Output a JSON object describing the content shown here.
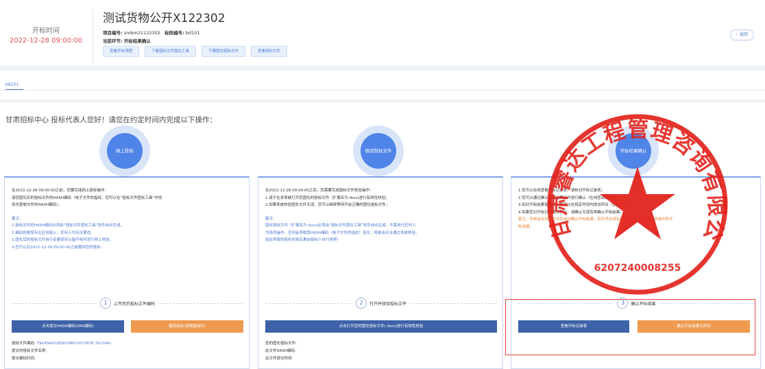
{
  "header": {
    "time_label": "开标时间",
    "time_value": "2022-12-28 09:00:00",
    "title": "测试货物公开X122302",
    "project_no_label": "项目编号:",
    "project_no": "smbm22122302",
    "section_no_label": "标段编号:",
    "section_no": "bd101",
    "stage_label": "当前环节:",
    "stage_value": "开标结果确认",
    "buttons": [
      "查看开标流程",
      "下载招标文件固化工具",
      "下载固化招标文件",
      "查看招标文件"
    ],
    "back_label": "返回"
  },
  "tabs": {
    "active": "bd101"
  },
  "greeting": "甘肃招标中心 投标代表人您好！请您在约定时间内完成以下操作：",
  "steps": [
    {
      "circle_label": "网上投标",
      "lines": [
        {
          "t": "在2022-12-28 09:00:00之前，您要完成网上投标操作：",
          "c": ""
        },
        {
          "t": "请您固化后的投标文件的HASH编码（电子文件的指纹，您可以在“投标文件固化工具”中找",
          "c": ""
        },
        {
          "t": "到并复制文件的HASH编码）。",
          "c": ""
        },
        {
          "t": "备注：",
          "c": "blue"
        },
        {
          "t": "1.投标文件的HASH编码必须由“投标文件固化工具”软件自动生成。",
          "c": "blue"
        },
        {
          "t": "2.编码将被保存在区块链上，任何人均无法更改。",
          "c": "blue"
        },
        {
          "t": "3.固化后的投标文件自行妥善保存以备开标时进行网上核验。",
          "c": "blue"
        },
        {
          "t": "4.您可以在2022-12-28 09:00:00之前撤回您的投标。",
          "c": "blue"
        }
      ],
      "divider_num": "1",
      "divider_text": "上传您的投标文件编码",
      "buttons": [
        {
          "label": "点击提交HASH编码(SM3编码)",
          "style": "blue"
        },
        {
          "label": "撤回投标(请慎重操作)",
          "style": "orange"
        }
      ],
      "info": [
        {
          "label": "投标文件编码:",
          "value": "79e30e62c83b19967e572636 7bc244c"
        },
        {
          "label": "提交的投标文件名称:",
          "value": ""
        },
        {
          "label": "提交编码时间:",
          "value": ""
        }
      ]
    },
    {
      "circle_label": "核验投标文件",
      "lines": [
        {
          "t": "在2022-12-28 09:00:00之后，您需要完成投标文件核验操作：",
          "c": ""
        },
        {
          "t": "1.请于在本系统打开您固化的投标文件（扩展名为.tbxx)进行有效性核验；",
          "c": ""
        },
        {
          "t": "2.如果系统核验固化文件无误，您可以继续等待开启正确的固化投标文件；",
          "c": ""
        },
        {
          "t": "备注：",
          "c": "blue"
        },
        {
          "t": "固化投标文件（扩展名为.tbxx)必须由“投标文件固化工具”软件自动生成，不需进行任何人",
          "c": "blue"
        },
        {
          "t": "为修改操作，否则会导致其HASH编码（电子文件的指纹）变化，将被会无法通过系统核验。",
          "c": "blue"
        },
        {
          "t": "因此导致的投标失败后果由投标人自行承担！",
          "c": "blue"
        }
      ],
      "divider_num": "2",
      "divider_text": "打开并核验投标文件",
      "buttons": [
        {
          "label": "点击打开您的固化投标文件(.tbxx)进行有效性核验",
          "style": "blue"
        }
      ],
      "info": [
        {
          "label": "您的固化投标文件:",
          "value": ""
        },
        {
          "label": "此文件HASH编码:",
          "value": ""
        },
        {
          "label": "此文件提交时间:",
          "value": ""
        }
      ]
    },
    {
      "circle_label": "开标结果确认",
      "lines": [
        {
          "t": "1.您可以在线查看开标记录表，请核对开标记录表；",
          "c": ""
        },
        {
          "t": "2.您可以通过确认开标结果操作进行确认（在线签名确认）；",
          "c": ""
        },
        {
          "t": "3.如对开标结果有异议，您可以在规定时间内提出异议（在线提交）；",
          "c": ""
        },
        {
          "t": "4.如果您对开标记录表无异议，请确认无误后再确认开标结果。",
          "c": ""
        },
        {
          "t": "备注：系统会在规定时间后自动确认开标结果，如无异议请及时操作，以免影响后续操作和评",
          "c": "orange"
        },
        {
          "t": "标进展。",
          "c": "orange"
        }
      ],
      "divider_num": "3",
      "divider_text": "确认开标结果",
      "buttons": [
        {
          "label": "查看开标记录表",
          "style": "blue"
        },
        {
          "label": "确认开标结果无异议",
          "style": "orange"
        }
      ],
      "info": []
    }
  ],
  "stamp": {
    "company": "甘肃睿达工程管理咨询有限公司",
    "code": "6207240008255",
    "color": "#e3241d"
  },
  "colors": {
    "primary": "#4f84e8",
    "button_blue": "#3d62a8",
    "button_orange": "#ee9a4f",
    "alert": "#e05050"
  }
}
